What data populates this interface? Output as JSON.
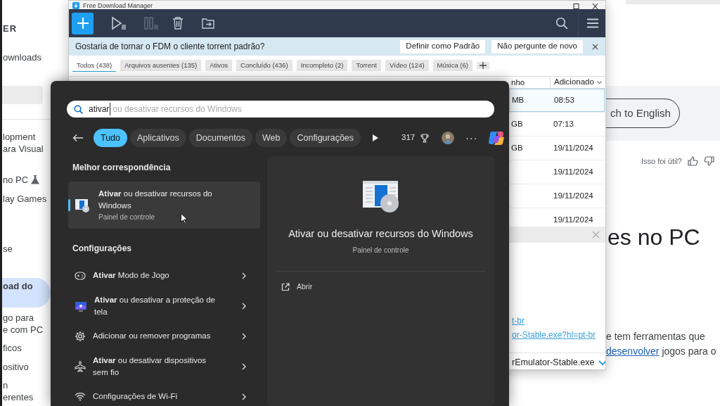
{
  "browser": {
    "sidebar": {
      "items": [
        {
          "kind": "title",
          "lines": [
            "ER"
          ],
          "selected": false
        },
        {
          "kind": "link",
          "lines": [
            "ownloads"
          ],
          "selected": false
        },
        {
          "kind": "field",
          "selected": false
        },
        {
          "kind": "link",
          "lines": [
            "lopment",
            "ara Visual"
          ],
          "selected": false
        },
        {
          "kind": "labs",
          "lines": [
            "no PC"
          ],
          "selected": false
        },
        {
          "kind": "link",
          "lines": [
            "lay Games"
          ],
          "selected": false
        },
        {
          "kind": "link",
          "lines": [
            "se"
          ],
          "selected": false
        },
        {
          "kind": "link",
          "lines": [
            "oad do"
          ],
          "selected": true
        },
        {
          "kind": "link",
          "lines": [
            "go para",
            "e com PC"
          ],
          "selected": false
        },
        {
          "kind": "link",
          "lines": [
            "ficos"
          ],
          "selected": false
        },
        {
          "kind": "link",
          "lines": [
            "ositivo"
          ],
          "selected": false
        },
        {
          "kind": "link",
          "lines": [
            "n",
            "erentes"
          ],
          "selected": false
        }
      ]
    },
    "language_button": "ch to English",
    "feedback": "Isso foi útil?",
    "heading": "es no PC",
    "paragraph": {
      "line_1": "e tem ferramentas que",
      "link": "desenvolver",
      "rest": "jogos para o"
    }
  },
  "fdm": {
    "title": "Free Download Manager",
    "toolbar": [
      {
        "kind": "add",
        "disabled": false
      },
      {
        "kind": "start",
        "disabled": false
      },
      {
        "kind": "pause",
        "disabled": true
      },
      {
        "kind": "delete",
        "disabled": false
      },
      {
        "kind": "move",
        "disabled": false
      }
    ],
    "notification": {
      "text": "Gostaria de tornar o FDM o cliente torrent padrão?",
      "buttons": [
        "Definir como Padrão",
        "Não pergunte de novo"
      ]
    },
    "tabs": [
      {
        "label": "Todos (438)",
        "selected": true
      },
      {
        "label": "Arquivos ausentes (135)",
        "selected": false
      },
      {
        "label": "Ativos",
        "selected": false
      },
      {
        "label": "Concluído (436)",
        "selected": false
      },
      {
        "label": "Incompleto (2)",
        "selected": false
      },
      {
        "label": "Torrent",
        "selected": false
      },
      {
        "label": "Vídeo (124)",
        "selected": false
      },
      {
        "label": "Música (6)",
        "selected": false
      }
    ],
    "table": {
      "columns": [
        "nho",
        "Adicionado"
      ],
      "rows": [
        {
          "size": "MB",
          "added": "08:53",
          "selected": true
        },
        {
          "size": "GB",
          "added": "07:13",
          "selected": false
        },
        {
          "size": "GB",
          "added": "19/11/2024",
          "selected": false
        },
        {
          "added": "19/11/2024",
          "selected": false
        },
        {
          "added": "19/11/2024",
          "selected": false
        },
        {
          "added": "19/11/2024",
          "selected": false
        }
      ]
    },
    "details": {
      "links": [
        "t-br",
        "or-Stable.exe?hl=pt-br"
      ],
      "file": "rEmulator-Stable.exe"
    }
  },
  "search": {
    "value": "ativar",
    "suggestion": "ou desativar recursos do Windows",
    "filters": [
      {
        "label": "Tudo",
        "selected": true
      },
      {
        "label": "Aplicativos",
        "selected": false
      },
      {
        "label": "Documentos",
        "selected": false
      },
      {
        "label": "Web",
        "selected": false
      },
      {
        "label": "Configurações",
        "selected": false
      }
    ],
    "points": "317",
    "more": "···",
    "best_match": {
      "heading": "Melhor correspondência",
      "title": "**Ativar** ou desativar recursos do Windows",
      "subtitle": "Painel de controle",
      "selected": true
    },
    "settings": {
      "heading": "Configurações",
      "items": [
        {
          "kind": "gamepad",
          "text": "**Ativar** Modo de Jogo"
        },
        {
          "kind": "screensaver",
          "text": "**Ativar** ou desativar a proteção de tela"
        },
        {
          "kind": "gear",
          "text": "Adicionar ou remover programas"
        },
        {
          "kind": "airplane",
          "text": "**Ativar** ou desativar dispositivos sem fio"
        },
        {
          "kind": "wifi",
          "text": "Configurações de Wi-Fi"
        }
      ]
    },
    "preview": {
      "title": "Ativar ou desativar recursos do Windows",
      "subtitle": "Painel de controle",
      "actions": [
        "Abrir"
      ]
    }
  }
}
